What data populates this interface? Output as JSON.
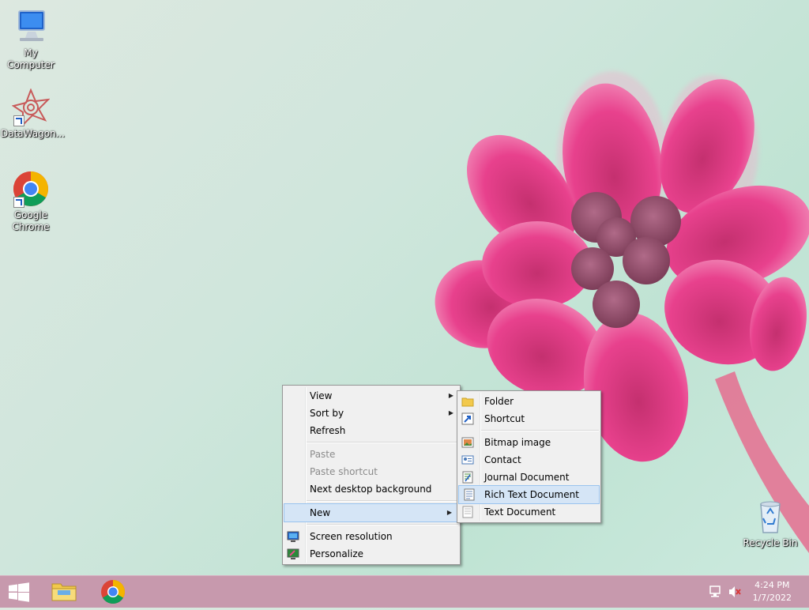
{
  "desktop": {
    "icons": [
      {
        "label": "My Computer",
        "icon": "computer-icon"
      },
      {
        "label": "DataWagon...",
        "icon": "datawagon-icon"
      },
      {
        "label": "Google Chrome",
        "icon": "chrome-icon"
      },
      {
        "label": "Recycle Bin",
        "icon": "recycle-bin-icon"
      }
    ]
  },
  "context_menu": {
    "items": [
      {
        "label": "View"
      },
      {
        "label": "Sort by"
      },
      {
        "label": "Refresh"
      },
      {
        "label": "Paste"
      },
      {
        "label": "Paste shortcut"
      },
      {
        "label": "Next desktop background"
      },
      {
        "label": "New"
      },
      {
        "label": "Screen resolution"
      },
      {
        "label": "Personalize"
      }
    ]
  },
  "new_submenu": {
    "items": [
      {
        "label": "Folder",
        "icon": "folder-icon"
      },
      {
        "label": "Shortcut",
        "icon": "shortcut-icon"
      },
      {
        "label": "Bitmap image",
        "icon": "bitmap-icon"
      },
      {
        "label": "Contact",
        "icon": "contact-icon"
      },
      {
        "label": "Journal Document",
        "icon": "journal-icon"
      },
      {
        "label": "Rich Text Document",
        "icon": "rtf-icon"
      },
      {
        "label": "Text Document",
        "icon": "text-document-icon"
      }
    ]
  },
  "taskbar": {
    "time": "4:24 PM",
    "date": "1/7/2022",
    "pinned": [
      "file-explorer-icon",
      "chrome-icon"
    ]
  },
  "colors": {
    "taskbar": "#c799ad",
    "menu_highlight": "#d5e5f6",
    "flower": "#e8418d"
  }
}
